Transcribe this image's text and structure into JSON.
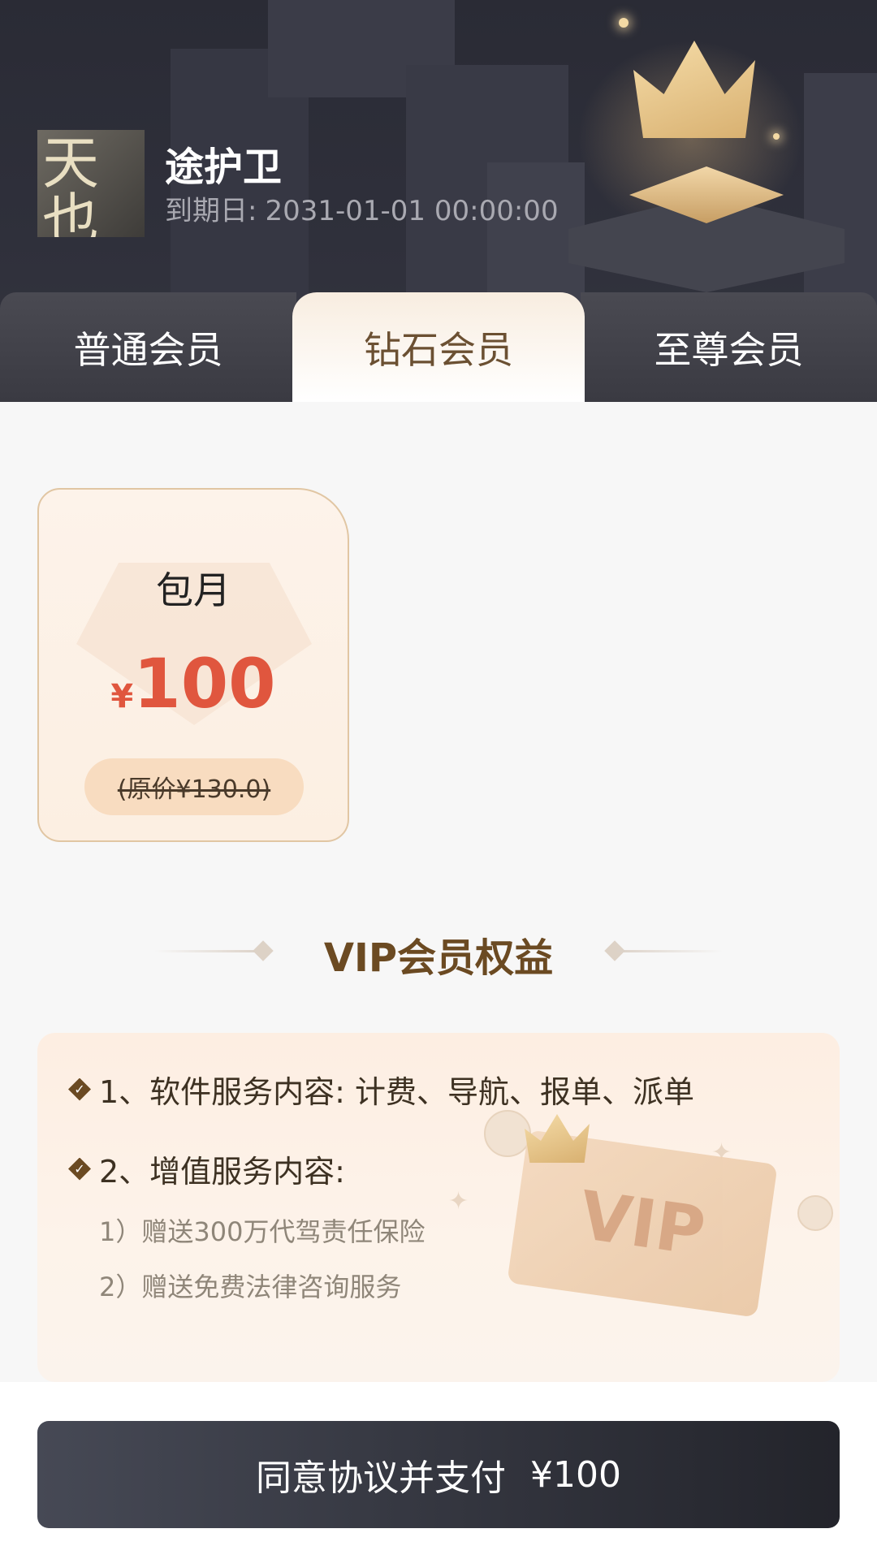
{
  "user": {
    "name": "途护卫",
    "expire_label": "到期日:",
    "expire_value": "2031-01-01 00:00:00",
    "avatar_text": "天也"
  },
  "tabs": [
    {
      "label": "普通会员",
      "active": false
    },
    {
      "label": "钻石会员",
      "active": true
    },
    {
      "label": "至尊会员",
      "active": false
    }
  ],
  "plan": {
    "name": "包月",
    "currency": "¥",
    "price": "100",
    "original": "(原价¥130.0)"
  },
  "benefits": {
    "title": "VIP会员权益",
    "items": [
      {
        "text": "1、软件服务内容: 计费、导航、报单、派单"
      },
      {
        "text": "2、增值服务内容:"
      }
    ],
    "sub_items": [
      "1）赠送300万代驾责任保险",
      "2）赠送免费法律咨询服务"
    ],
    "art_text": "VIP"
  },
  "pay": {
    "label": "同意协议并支付",
    "amount": "¥100"
  },
  "colors": {
    "header_bg": "#2f303b",
    "accent_price": "#e0563e",
    "title_brown": "#6b4a22",
    "pay_button": "#2e3039"
  }
}
